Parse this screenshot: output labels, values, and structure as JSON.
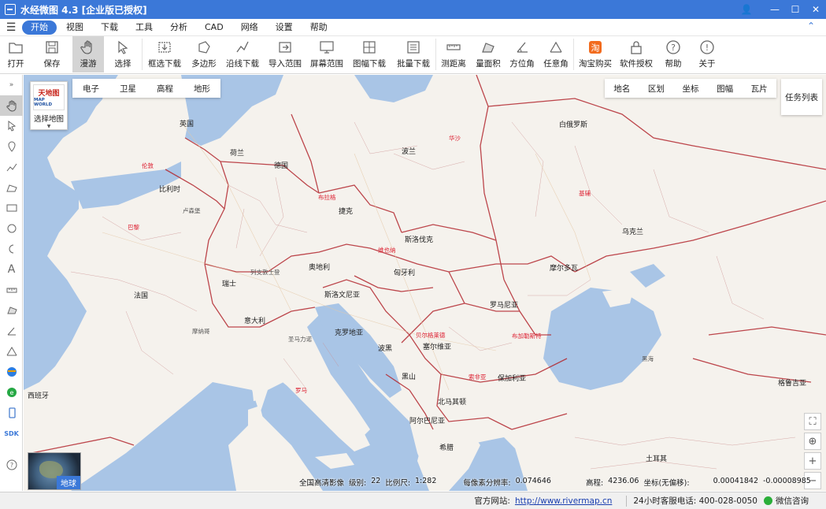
{
  "window": {
    "title": "水经微图 4.3 [企业版已授权]"
  },
  "menu": {
    "items": [
      "开始",
      "视图",
      "下载",
      "工具",
      "分析",
      "CAD",
      "网络",
      "设置",
      "帮助"
    ],
    "active_index": 0
  },
  "toolbar": {
    "open": "打开",
    "save": "保存",
    "pan": "漫游",
    "select": "选择",
    "box_download": "框选下载",
    "polygon": "多边形",
    "line_download": "沿线下载",
    "import_range": "导入范围",
    "screen_range": "屏幕范围",
    "frame_download": "图幅下载",
    "batch_download": "批量下载",
    "measure_dist": "测距离",
    "measure_area": "量面积",
    "azimuth": "方位角",
    "any_angle": "任意角",
    "taobao": "淘宝购买",
    "license": "软件授权",
    "help": "帮助",
    "about": "关于"
  },
  "map_panel": {
    "select_map_label": "选择地图",
    "logo_line1": "天地图",
    "logo_line2": "MAP WORLD",
    "map_types": [
      "电子",
      "卫星",
      "高程",
      "地形"
    ],
    "layers": [
      "地名",
      "区划",
      "坐标",
      "图幅",
      "瓦片"
    ],
    "task_list": "任务列表",
    "globe_label": "地球"
  },
  "map_labels": {
    "uk": "英国",
    "london": "伦敦",
    "netherlands": "荷兰",
    "belgium": "比利时",
    "luxembourg": "卢森堡",
    "germany": "德国",
    "france": "法国",
    "paris": "巴黎",
    "switzerland": "瑞士",
    "czech": "捷克",
    "prague": "布拉格",
    "austria": "奥地利",
    "vienna": "维也纳",
    "slovakia": "斯洛伐克",
    "hungary": "匈牙利",
    "poland": "波兰",
    "warsaw": "华沙",
    "belarus": "白俄罗斯",
    "ukraine": "乌克兰",
    "kyiv": "基辅",
    "moldova": "摩尔多瓦",
    "romania": "罗马尼亚",
    "bucharest": "布加勒斯特",
    "bulgaria": "保加利亚",
    "sofia": "索非亚",
    "serbia": "塞尔维亚",
    "belgrade": "贝尔格莱德",
    "croatia": "克罗地亚",
    "bosnia": "波黑",
    "slovenia": "斯洛文尼亚",
    "montenegro": "黑山",
    "albania": "阿尔巴尼亚",
    "macedonia": "北马其顿",
    "italy": "意大利",
    "rome": "罗马",
    "greece": "希腊",
    "spain": "西班牙",
    "monaco": "摩纳哥",
    "san_marino": "圣马力诺",
    "black_sea": "黑海",
    "georgia": "格鲁吉亚",
    "turkey": "土耳其",
    "liechtenstein": "列支敦士登"
  },
  "info": {
    "source": "全国高清影像",
    "level_label": "级别:",
    "level": "22",
    "scale_label": "比例尺:",
    "scale": "1:282",
    "resolution_label": "每像素分辨率:",
    "resolution": "0.074646",
    "elevation_label": "高程:",
    "elevation": "4236.06",
    "coord_label": "坐标(无偏移):",
    "coord_x": "0.00041842",
    "coord_y": "-0.00008985"
  },
  "status": {
    "website_label": "官方网站:",
    "website": "http://www.rivermap.cn",
    "phone": "24小时客服电话: 400-028-0050",
    "wechat": "微信咨询"
  }
}
